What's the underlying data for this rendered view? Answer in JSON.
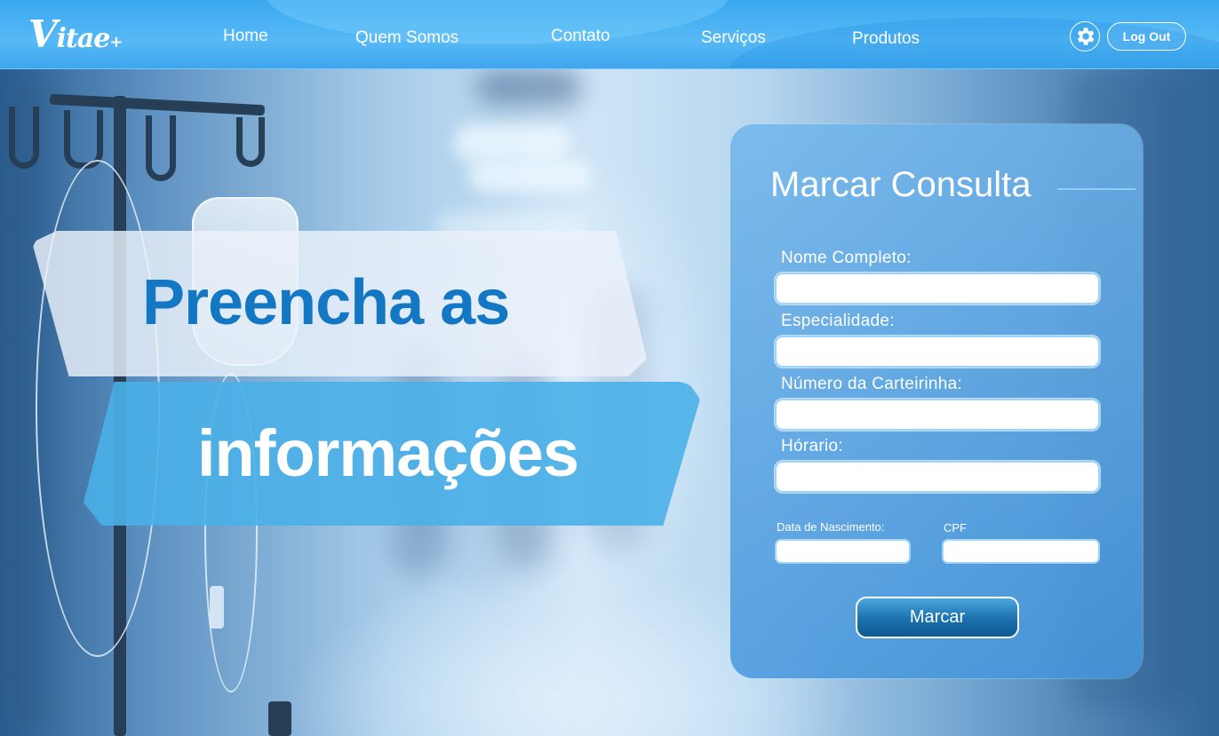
{
  "logo": {
    "text_initial": "V",
    "text_rest": "itae",
    "mark": "+"
  },
  "nav": {
    "links": [
      "Home",
      "Quem Somos",
      "Contato",
      "Serviços",
      "Produtos"
    ],
    "logout_label": "Log Out"
  },
  "hero": {
    "line1": "Preencha as",
    "line2": "informações"
  },
  "form": {
    "title": "Marcar Consulta",
    "fields": [
      "Nome Completo:",
      "Especialidade:",
      "Número da Carteirinha:",
      "Hórario:"
    ],
    "birth_label": "Data de Nascimento:",
    "cpf_label": "CPF",
    "submit_label": "Marcar"
  },
  "colors": {
    "nav_bg": "#3aa9f0",
    "headline_blue": "#1477c4",
    "ribbon_blue": "#4ab0e8",
    "button_blue": "#1b70ad"
  },
  "icons": {
    "settings": "gear-icon"
  }
}
